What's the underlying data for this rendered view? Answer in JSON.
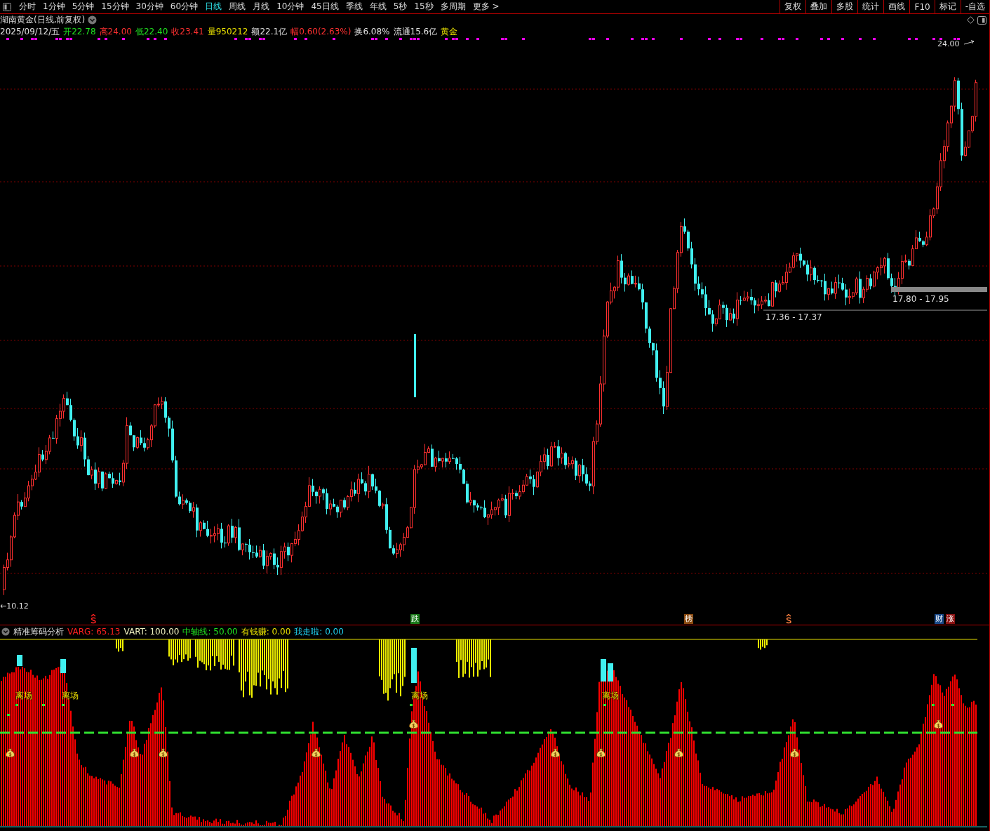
{
  "toolbar": {
    "periods": [
      {
        "label": "分时",
        "selected": false
      },
      {
        "label": "1分钟",
        "selected": false
      },
      {
        "label": "5分钟",
        "selected": false
      },
      {
        "label": "15分钟",
        "selected": false
      },
      {
        "label": "30分钟",
        "selected": false
      },
      {
        "label": "60分钟",
        "selected": false
      },
      {
        "label": "日线",
        "selected": true
      },
      {
        "label": "周线",
        "selected": false
      },
      {
        "label": "月线",
        "selected": false
      },
      {
        "label": "10分钟",
        "selected": false
      },
      {
        "label": "45日线",
        "selected": false
      },
      {
        "label": "季线",
        "selected": false
      },
      {
        "label": "年线",
        "selected": false
      },
      {
        "label": "5秒",
        "selected": false
      },
      {
        "label": "15秒",
        "selected": false
      },
      {
        "label": "多周期",
        "selected": false
      },
      {
        "label": "更多 >",
        "selected": false
      }
    ],
    "tools": [
      "复权",
      "叠加",
      "多股",
      "统计",
      "画线",
      "F10",
      "标记",
      "-自选"
    ]
  },
  "stock_header": {
    "title": "湖南黄金(日线,前复权)",
    "quote": [
      {
        "text": "2025/09/12/五",
        "color": "#e0e0e0"
      },
      {
        "text": "开22.78",
        "color": "#20e020"
      },
      {
        "text": "高24.00",
        "color": "#ff3030"
      },
      {
        "text": "低22.40",
        "color": "#20e020"
      },
      {
        "text": "收23.41",
        "color": "#ff3030"
      },
      {
        "text": "量950212",
        "color": "#e8e000"
      },
      {
        "text": "额22.1亿",
        "color": "#e0e0e0"
      },
      {
        "text": "幅0.60(2.63%)",
        "color": "#ff3030"
      },
      {
        "text": "换6.08%",
        "color": "#e0e0e0"
      },
      {
        "text": "流通15.6亿",
        "color": "#e0e0e0"
      },
      {
        "text": "黄金",
        "color": "#e8e000"
      }
    ]
  },
  "price_chart": {
    "high_label": "24.00",
    "low_label": "←10.12",
    "ranges": [
      "17.36 - 17.37",
      "17.80 - 17.95"
    ],
    "markers": [
      {
        "kind": "dollar",
        "color": "#ff2020"
      },
      {
        "kind": "badge",
        "label": "跌",
        "color": "#1a7a1a"
      },
      {
        "kind": "badge",
        "label": "榜",
        "color": "#8a4a10"
      },
      {
        "kind": "dollar",
        "color": "#ff8040"
      },
      {
        "kind": "badge",
        "label": "财",
        "color": "#1a4a8a"
      },
      {
        "kind": "badge",
        "label": "涨",
        "color": "#8a1010"
      }
    ]
  },
  "indicator": {
    "name": "精准筹码分析",
    "values": [
      {
        "text": "VARG: 65.13",
        "color": "#ff2020"
      },
      {
        "text": "VART: 100.00",
        "color": "#f0f0c0"
      },
      {
        "text": "中轴线: 50.00",
        "color": "#20e020"
      },
      {
        "text": "有钱赚: 0.00",
        "color": "#e8e000"
      },
      {
        "text": "我走啦: 0.00",
        "color": "#20d0f0"
      }
    ],
    "exit_labels": [
      "离场",
      "离场",
      "离场",
      "离场"
    ]
  }
}
